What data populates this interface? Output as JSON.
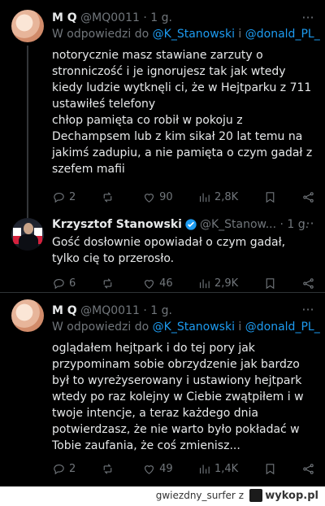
{
  "tweets": [
    {
      "name": "M Q",
      "handle": "@MQ0011",
      "dot": "·",
      "time": "1 g.",
      "reply_prefix": "W odpowiedzi do",
      "reply_mention1": "@K_Stanowski",
      "reply_and": "i",
      "reply_mention2": "@donald_PL_",
      "text": "notorycznie masz stawiane zarzuty o stronniczość i je ignorujesz tak jak wtedy kiedy ludzie wytknęli ci, że w Hejtparku z 711 ustawiłeś telefony\nchłop pamięta co robił w pokoju z Dechampsem lub z kim sikał 20 lat temu na jakimś zadupiu, a nie pamięta o czym gadał z szefem mafii",
      "replies": "2",
      "retweets": "",
      "likes": "90",
      "views": "2,8K"
    },
    {
      "name": "Krzysztof Stanowski",
      "handle": "@K_Stanow...",
      "dot": "·",
      "time": "1 g.",
      "text": "Gość dosłownie opowiadał o czym gadał, tylko cię to przerosło.",
      "replies": "6",
      "retweets": "",
      "likes": "46",
      "views": "2,9K"
    },
    {
      "name": "M Q",
      "handle": "@MQ0011",
      "dot": "·",
      "time": "1 g.",
      "reply_prefix": "W odpowiedzi do",
      "reply_mention1": "@K_Stanowski",
      "reply_and": "i",
      "reply_mention2": "@donald_PL_",
      "text": "oglądałem hejtpark i do tej pory jak przypominam sobie obrzydzenie jak bardzo był to wyreżyserowany i ustawiony hejtpark wtedy po raz kolejny w Ciebie zwątpiłem i w twoje intencje, a teraz każdego dnia potwierdzasz, że nie warto było pokładać w Tobie zaufania, że coś zmienisz...",
      "replies": "2",
      "retweets": "",
      "likes": "49",
      "views": "1,4K"
    }
  ],
  "footer": {
    "user": "gwiezdny_surfer",
    "z": "z",
    "site": "wykop.pl"
  },
  "colors": {
    "accent": "#1d9bf0",
    "muted": "#71767b",
    "bg": "#000000"
  },
  "icons": [
    "reply-icon",
    "retweet-icon",
    "like-icon",
    "views-icon",
    "bookmark-icon",
    "share-icon",
    "more-icon",
    "verified-icon"
  ]
}
